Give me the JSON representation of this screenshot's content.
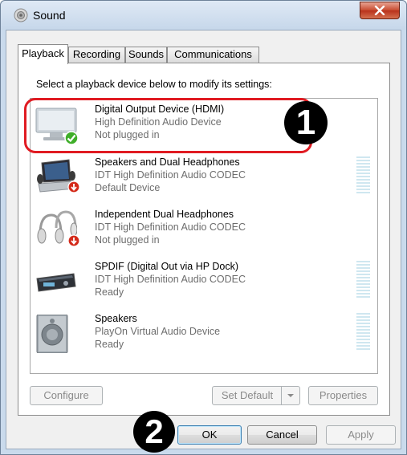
{
  "window": {
    "title": "Sound"
  },
  "tabs": [
    {
      "label": "Playback",
      "active": true
    },
    {
      "label": "Recording",
      "active": false
    },
    {
      "label": "Sounds",
      "active": false
    },
    {
      "label": "Communications",
      "active": false
    }
  ],
  "playback": {
    "instruction": "Select a playback device below to modify its settings:",
    "devices": [
      {
        "name": "Digital Output Device (HDMI)",
        "description": "High Definition Audio Device",
        "status": "Not plugged in",
        "icon": "monitor-icon",
        "badge": "green-check-icon",
        "selected": true
      },
      {
        "name": "Speakers and Dual Headphones",
        "description": "IDT High Definition Audio CODEC",
        "status": "Default Device",
        "icon": "laptop-icon",
        "badge": "red-down-arrow-icon"
      },
      {
        "name": "Independent Dual Headphones",
        "description": "IDT High Definition Audio CODEC",
        "status": "Not plugged in",
        "icon": "headphones-icon",
        "badge": "red-down-arrow-icon"
      },
      {
        "name": "SPDIF (Digital Out via HP Dock)",
        "description": "IDT High Definition Audio CODEC",
        "status": "Ready",
        "icon": "receiver-icon"
      },
      {
        "name": "Speakers",
        "description": "PlayOn Virtual Audio Device",
        "status": "Ready",
        "icon": "speaker-icon"
      }
    ],
    "buttons": {
      "configure": "Configure",
      "set_default": "Set Default",
      "properties": "Properties"
    }
  },
  "dialog_buttons": {
    "ok": "OK",
    "cancel": "Cancel",
    "apply": "Apply"
  },
  "annotations": {
    "step1": "1",
    "step2": "2"
  },
  "colors": {
    "highlight_ring": "#e01b22",
    "badge_bg": "#000000",
    "level_meter": "#cfe7f0"
  }
}
